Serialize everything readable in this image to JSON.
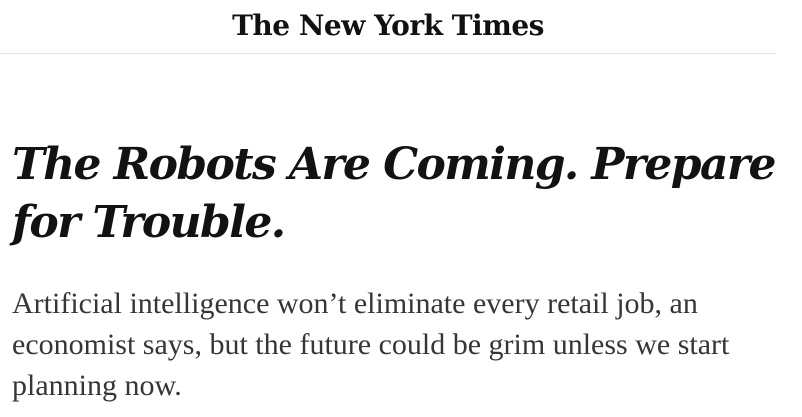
{
  "masthead": {
    "logo_text": "The New York Times"
  },
  "article": {
    "headline": "The Robots Are Coming. Prepare for Trouble.",
    "summary": "Artificial intelligence won’t eliminate every retail job, an economist says, but the future could be grim unless we start planning now."
  }
}
